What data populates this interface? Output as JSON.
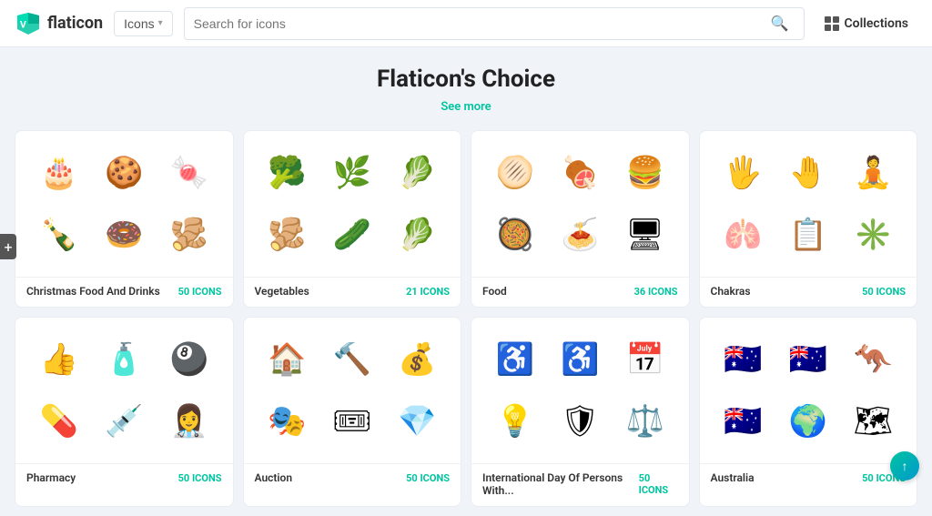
{
  "header": {
    "logo_text": "flaticon",
    "nav_label": "Icons",
    "search_placeholder": "Search for icons",
    "collections_label": "Collections"
  },
  "main": {
    "title": "Flaticon's Choice",
    "see_more": "See more",
    "cards": [
      {
        "name": "Christmas Food And Drinks",
        "count": "50 ICONS",
        "icons": [
          "🎂",
          "🍪",
          "🍬",
          "🍾",
          "🍩",
          "🫚"
        ]
      },
      {
        "name": "Vegetables",
        "count": "21 ICONS",
        "icons": [
          "🥦",
          "🌿",
          "🥬",
          "🫚",
          "🥒",
          "🥬"
        ]
      },
      {
        "name": "Food",
        "count": "36 ICONS",
        "icons": [
          "🫓",
          "🍖",
          "🍔",
          "🥘",
          "🍝",
          "🖥"
        ]
      },
      {
        "name": "Chakras",
        "count": "50 ICONS",
        "icons": [
          "🖐",
          "🤚",
          "🧘",
          "🫁",
          "📋",
          "✳️"
        ]
      },
      {
        "name": "Pharmacy",
        "count": "50 ICONS",
        "icons": [
          "👍",
          "🧴",
          "🎱",
          "💊",
          "💉",
          "👩‍⚕️"
        ]
      },
      {
        "name": "Auction",
        "count": "50 ICONS",
        "icons": [
          "🏠",
          "🔨",
          "💰",
          "🎭",
          "🎟",
          "💎"
        ]
      },
      {
        "name": "International Day Of Persons With...",
        "count": "50 ICONS",
        "icons": [
          "♿",
          "♿",
          "📅",
          "💡",
          "🛡",
          "⚖️"
        ]
      },
      {
        "name": "Australia",
        "count": "50 ICONS",
        "icons": [
          "🇦🇺",
          "🇦🇺",
          "🦘",
          "🇦🇺",
          "🌍",
          "🗺"
        ]
      }
    ]
  },
  "add_label": "+",
  "scroll_top_label": "↑"
}
